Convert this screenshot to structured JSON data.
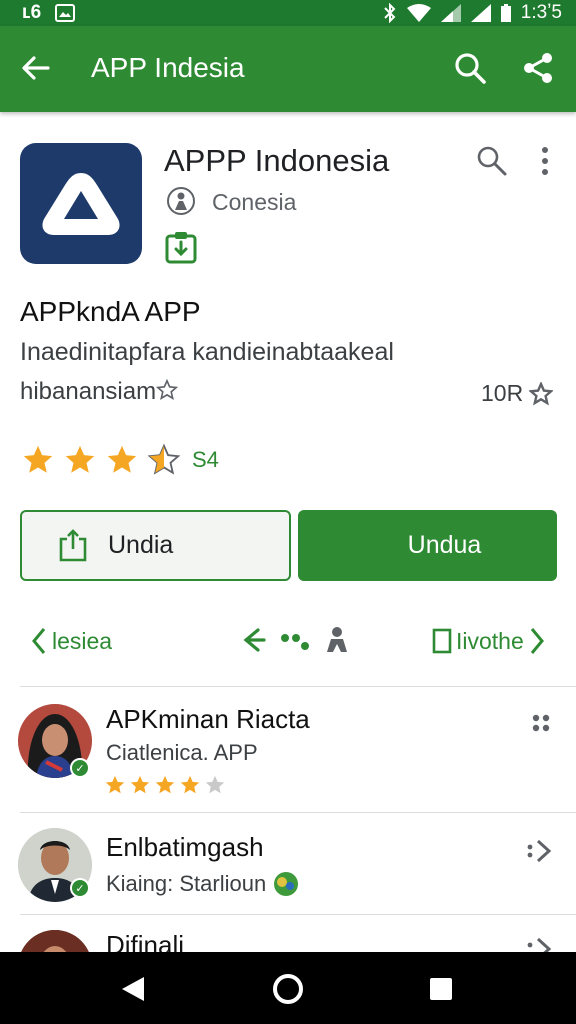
{
  "status_bar": {
    "left_text": "ʟ6",
    "time": "1:3ʼ5"
  },
  "app_bar": {
    "title": "APP Indesia"
  },
  "app": {
    "title": "APPP Indonesia",
    "developer": "Conesia",
    "subtitle": "APPkndA APP",
    "description": "Inaedinitapfara kandieinabtaakeal",
    "description2": "hibanansiam",
    "reviews_count": "10R",
    "rating_count": "S4",
    "rating": 3.5
  },
  "buttons": {
    "secondary_label": "Undia",
    "primary_label": "Undua"
  },
  "nav": {
    "left_label": "lesiea",
    "right_label": "Iivothe"
  },
  "reviews": [
    {
      "name": "APKminan Riacta",
      "subtitle": "Ciatlenica. APP",
      "stars": 4
    },
    {
      "name": "Enlbatimgash",
      "subtitle": "Kiaing: Starlioun"
    },
    {
      "name": "Difinali"
    }
  ],
  "colors": {
    "primary": "#2e8b34",
    "status_bar": "#1e7a2e",
    "app_icon_bg": "#1d3a6b",
    "star": "#f5a623"
  },
  "icons": [
    "arrow-back-icon",
    "search-icon",
    "share-icon",
    "more-vert-icon",
    "developer-icon",
    "download-badge-icon",
    "star-icon",
    "download-icon",
    "chevron-left-icon",
    "chevron-right-icon",
    "reply-icon",
    "grid-icon",
    "back-triangle-icon",
    "home-circle-icon",
    "recents-square-icon"
  ]
}
